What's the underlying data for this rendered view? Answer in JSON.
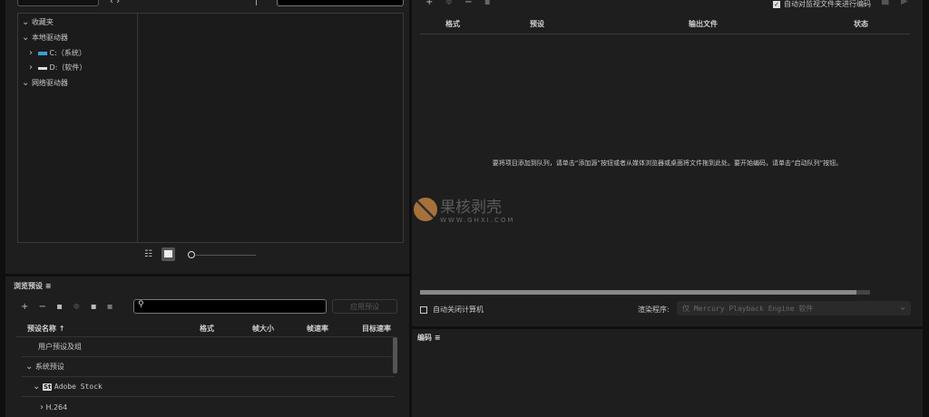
{
  "media_browser": {
    "tree": [
      {
        "label": "收藏夹",
        "expanded": true
      },
      {
        "label": "本地驱动器",
        "expanded": true
      },
      {
        "label": "C:（系统）",
        "expanded": false
      },
      {
        "label": "D:（软件）",
        "expanded": false
      },
      {
        "label": "网络驱动器",
        "expanded": true
      }
    ]
  },
  "preset_browser": {
    "title": "浏览预设",
    "apply_label": "应用预设",
    "search_placeholder": "",
    "columns": [
      "预设名称 ↑",
      "格式",
      "帧大小",
      "帧速率",
      "目标速率"
    ],
    "rows": [
      "用户预设及组",
      "系统预设",
      "Adobe Stock",
      "H.264"
    ],
    "stock_badge": "St"
  },
  "queue": {
    "auto_encode_label": "自动对监视文件夹进行编码",
    "auto_encode_checked": true,
    "columns": [
      "格式",
      "预设",
      "输出文件",
      "状态"
    ],
    "empty_message": "要将项目添加到队列，请单击“添加源”按钮或者从媒体浏览器或桌面将文件拖到此处。要开始编码，请单击“启动队列”按钮。",
    "progress": 0.97,
    "auto_shutdown_label": "自动关闭计算机",
    "auto_shutdown_checked": false,
    "renderer_label": "渲染程序:",
    "renderer_value": "仅 Mercury Playback Engine 软件"
  },
  "encoding": {
    "title": "编码"
  },
  "watermark": {
    "text": "果核剥壳",
    "url": "WWW.GHXI.COM"
  }
}
